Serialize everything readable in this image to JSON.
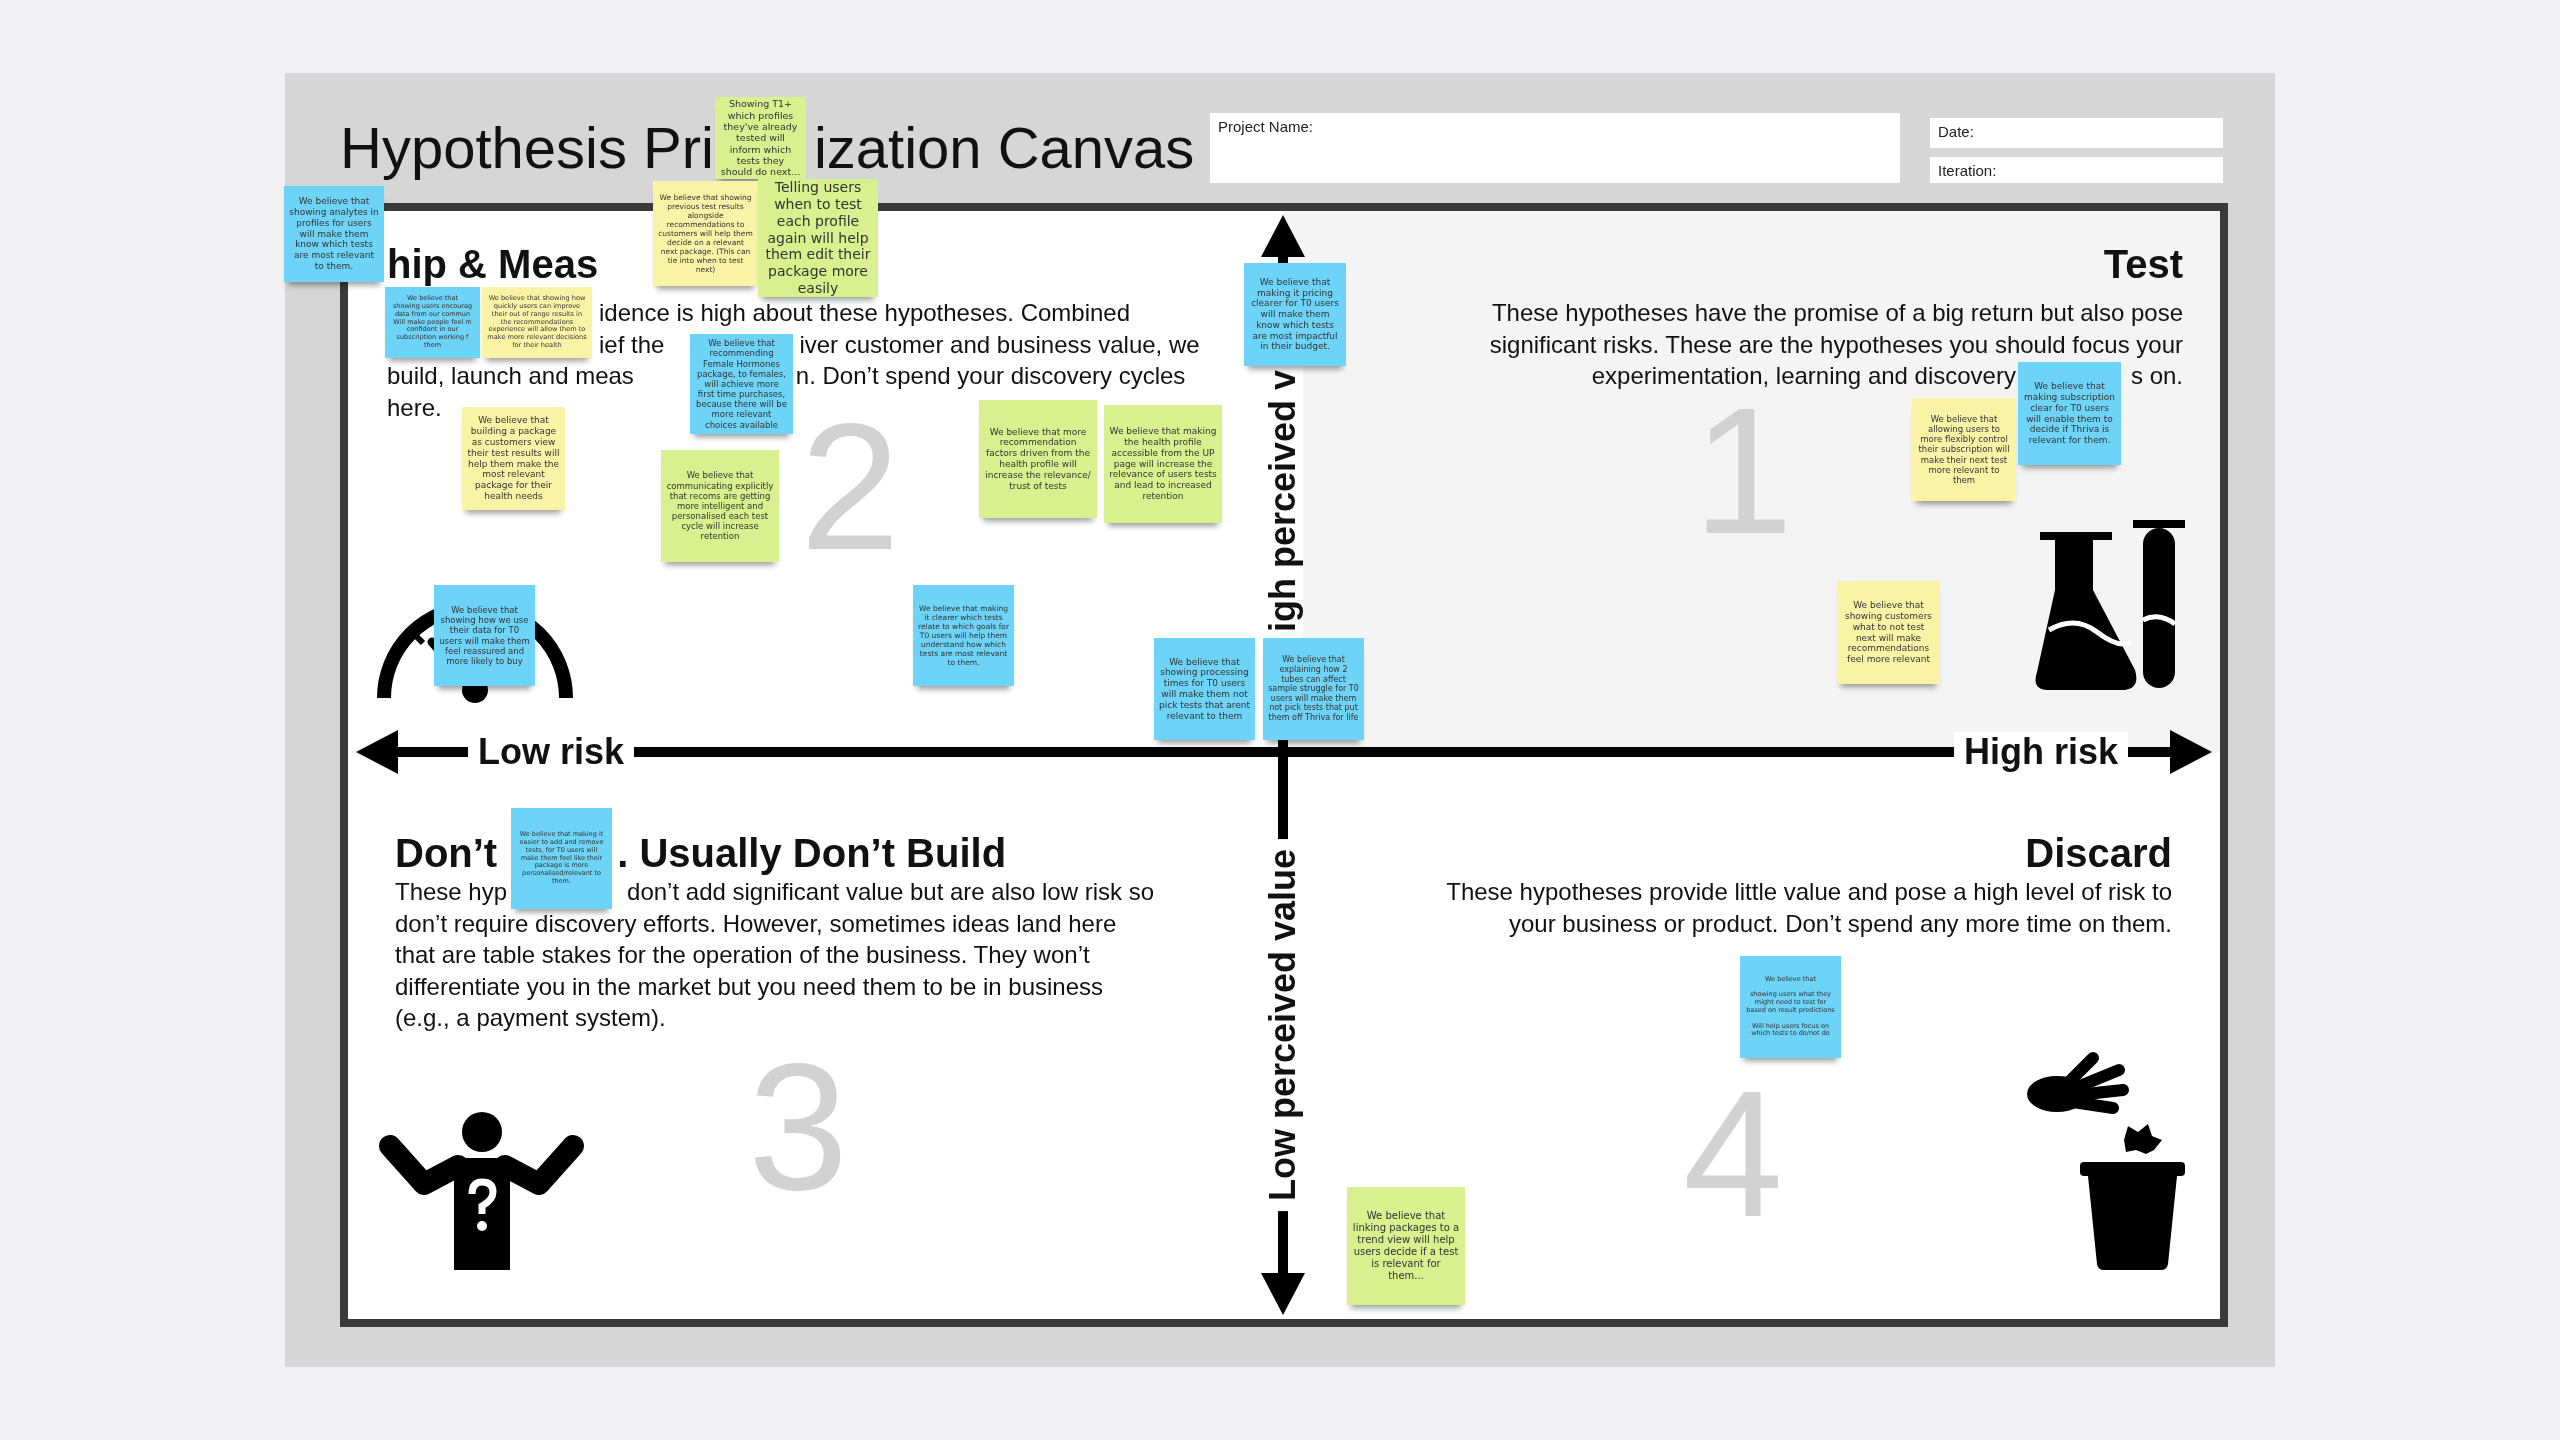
{
  "title_parts": [
    "Hypothesis Pri",
    "ization Canvas"
  ],
  "fields": [
    {
      "label": "Project Name:"
    },
    {
      "label": "Date:"
    },
    {
      "label": "Iteration:"
    }
  ],
  "quadrants": [
    {
      "heading_parts": [
        "hip & Meas"
      ],
      "number": "2",
      "lines": [
        [
          "idence is high about these hypotheses. Combined"
        ],
        [
          "ief the",
          "iver customer and business value, we"
        ],
        [
          "build, launch and meas",
          "n. Don’t spend your discovery cycles"
        ],
        [
          "here."
        ]
      ]
    },
    {
      "heading_parts": [
        "Test"
      ],
      "number": "1",
      "lines": [
        [
          "These hypotheses have the promise of a big return but also pose"
        ],
        [
          "significant risks. These are the hypotheses you should focus your"
        ],
        [
          "experimentation, learning and discovery",
          "s on."
        ]
      ]
    },
    {
      "heading_parts": [
        "Don’t",
        ". Usually Don’t Build"
      ],
      "number": "3",
      "lines": [
        [
          "These hyp",
          "don’t add significant value but are also low risk so"
        ],
        [
          "don’t require discovery efforts. However, sometimes ideas land here"
        ],
        [
          "that are table stakes for the operation of the business. They won’t"
        ],
        [
          "differentiate you in the market but you need them to be in business"
        ],
        [
          "(e.g., a payment system)."
        ]
      ]
    },
    {
      "heading_parts": [
        "Discard"
      ],
      "number": "4",
      "lines": [
        [
          "These hypotheses provide little value and pose a high level of risk to"
        ],
        [
          "your business or product. Don’t spend any more time on them."
        ]
      ]
    }
  ],
  "axes": {
    "low_risk": "Low risk",
    "high_risk": "High risk",
    "high_value": "igh perceived v",
    "low_value": "Low perceived value"
  },
  "stickies": [
    {
      "color": "#d8f08e",
      "text": "Showing T1+ which profiles they've already tested  will inform which tests they should do next..."
    },
    {
      "color": "#6dd3f7",
      "text": "We believe that showing analytes in profiles for users will make them know which tests are most relevant to them."
    },
    {
      "color": "#f9f3a6",
      "text": "We believe that showing previous test results alongside recommendations to customers will help them decide on a relevant next package. (This can tie into when to test next)"
    },
    {
      "color": "#d8f08e",
      "text": "Telling users when to test each profile again will help them edit their package more easily"
    },
    {
      "color": "#6dd3f7",
      "text": "We believe that\nshowing users encourag\ndata from our commun\nWill make people feel m\nconfident in our\nsubscription working f\nthem"
    },
    {
      "color": "#f9f3a6",
      "text": "We believe that showing how quickly users can improve their out of range results in the recommendations experience will allow them to make more relevant decisions for their health"
    },
    {
      "color": "#6dd3f7",
      "text": "We believe that recommending Female Hormones package, to females, will achieve more first time purchases, because there will be more relevant choices available"
    },
    {
      "color": "#f9f3a6",
      "text": "We believe that building a package as customers view their test results will help them make the most relevant package for their health needs"
    },
    {
      "color": "#d8f08e",
      "text": "We believe that communicating explicitly that recoms are getting more intelligent and personalised each test cycle will increase retention"
    },
    {
      "color": "#d8f08e",
      "text": "We believe that more recommendation factors driven from the health profile will increase the relevance/ trust of tests"
    },
    {
      "color": "#d8f08e",
      "text": "We believe that making the health profile accessible from the UP page will increase the relevance of users tests and lead to increased retention"
    },
    {
      "color": "#6dd3f7",
      "text": "We believe that making it pricing clearer for T0 users will make them know which tests are most impactful in their budget."
    },
    {
      "color": "#f9f3a6",
      "text": "We believe that allowing users to more flexibly control their subscription will make their next test more relevant to them"
    },
    {
      "color": "#6dd3f7",
      "text": "We believe that making subscription clear for T0 users will enable them to decide if Thriva is relevant for them."
    },
    {
      "color": "#6dd3f7",
      "text": "We believe that showing how we use their data for T0 users will make them feel reassured and more likely to buy"
    },
    {
      "color": "#6dd3f7",
      "text": "We believe that making it clearer which tests relate to which goals for T0 users will help them understand how which tests are most relevant to them."
    },
    {
      "color": "#6dd3f7",
      "text": "We believe that showing processing times for T0 users will make them not pick tests that arent relevant to them"
    },
    {
      "color": "#6dd3f7",
      "text": "We believe that explaining how 2 tubes can affect sample struggle for T0 users will make them not pick tests that put them off Thriva for life"
    },
    {
      "color": "#f9f3a6",
      "text": "We believe that showing customers what to not test next will make recommendations feel more relevant"
    },
    {
      "color": "#6dd3f7",
      "text": "We believe that making it easier to add and remove tests, for T0 users will make them feel like their package is more personalised/relevant to them."
    },
    {
      "color": "#6dd3f7",
      "text": "We believe that\n\nshowing users what they might need to test for based on result predictions\n\nWill help users focus on which tests to do/not do"
    },
    {
      "color": "#d8f08e",
      "text": "We believe that linking packages to a trend view will help users decide if a test is relevant for them..."
    }
  ]
}
